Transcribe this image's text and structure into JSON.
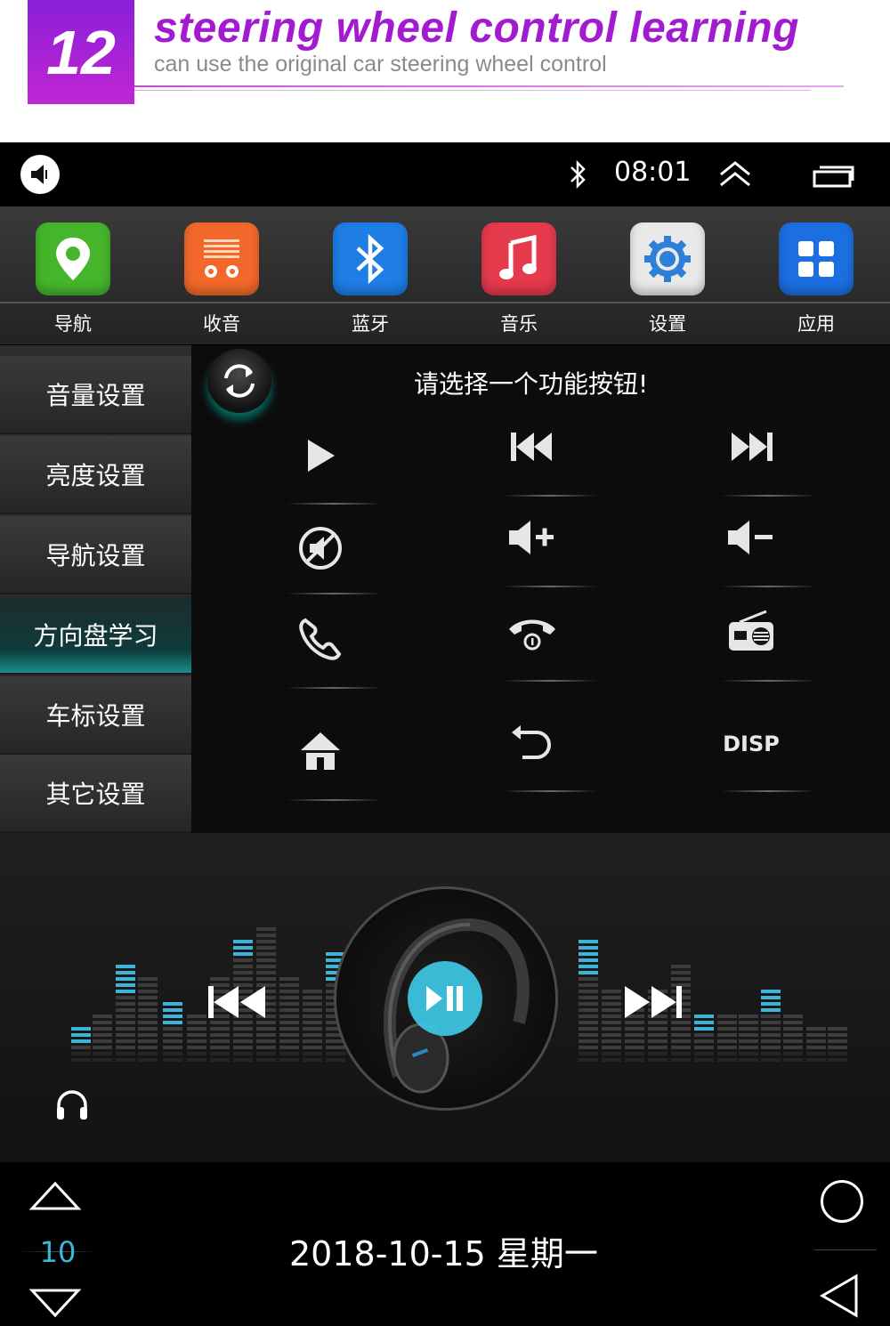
{
  "header": {
    "number": "12",
    "title": "steering wheel control learning",
    "subtitle": "can use the original car steering wheel control"
  },
  "statusbar": {
    "time": "08:01",
    "icons": [
      "volume-icon",
      "bluetooth-icon",
      "chevron-up-icon",
      "recent-apps-icon"
    ]
  },
  "apps": [
    {
      "label": "导航",
      "icon": "map-pin-icon",
      "color": "#45b52c"
    },
    {
      "label": "收音",
      "icon": "radio-icon",
      "color": "#f2682a"
    },
    {
      "label": "蓝牙",
      "icon": "bluetooth-icon",
      "color": "#1e7ee6"
    },
    {
      "label": "音乐",
      "icon": "music-note-icon",
      "color": "#e43a4c"
    },
    {
      "label": "设置",
      "icon": "gear-icon",
      "color": "#e9e9e9"
    },
    {
      "label": "应用",
      "icon": "apps-grid-icon",
      "color": "#1b6fe0"
    }
  ],
  "menu": {
    "items": [
      {
        "label": "音量设置"
      },
      {
        "label": "亮度设置"
      },
      {
        "label": "导航设置"
      },
      {
        "label": "方向盘学习",
        "active": true
      },
      {
        "label": "车标设置"
      },
      {
        "label": "其它设置"
      }
    ]
  },
  "panel": {
    "prompt": "请选择一个功能按钮!",
    "buttons": [
      "play-icon",
      "previous-track-icon",
      "next-track-icon",
      "mute-icon",
      "volume-up-icon",
      "volume-down-icon",
      "phone-answer-icon",
      "phone-hangup-icon",
      "radio-icon",
      "home-icon",
      "back-icon",
      "DISP"
    ],
    "disp_label": "DISP"
  },
  "player": {
    "icons": [
      "previous-icon",
      "play-pause-icon",
      "next-icon",
      "headphones-icon"
    ]
  },
  "navbar": {
    "page": "10",
    "date": "2018-10-15  星期一"
  }
}
